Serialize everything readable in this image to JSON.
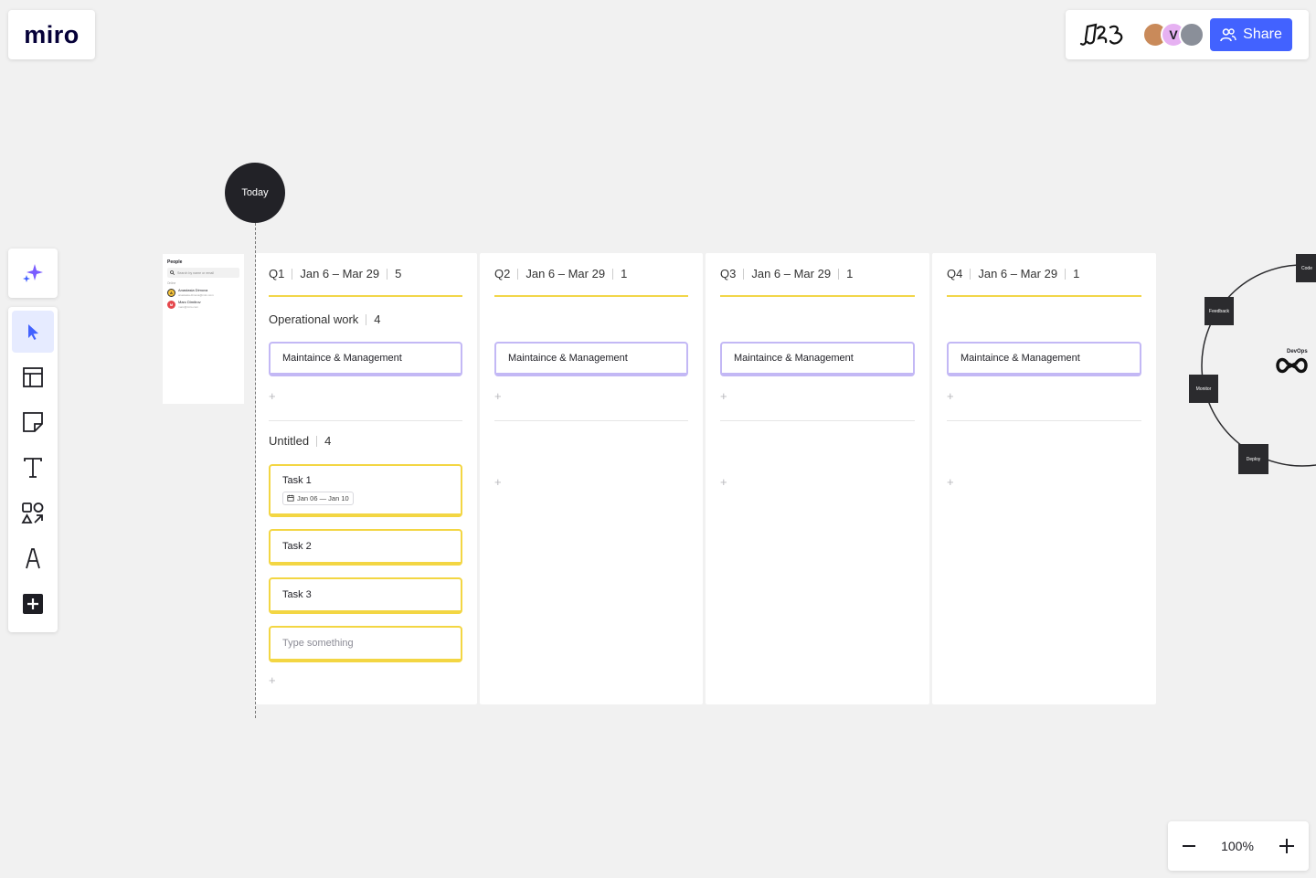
{
  "app": {
    "logo": "miro"
  },
  "header": {
    "share_label": "Share",
    "avatars": [
      {
        "initial": ""
      },
      {
        "initial": "V"
      },
      {
        "initial": ""
      }
    ]
  },
  "toolbar": {
    "tools": [
      "select",
      "templates",
      "sticky-note",
      "text",
      "shapes",
      "pen",
      "more"
    ],
    "active_tool": "select"
  },
  "zoom": {
    "level": "100%"
  },
  "timeline": {
    "today_label": "Today"
  },
  "people_panel": {
    "title": "People",
    "search_placeholder": "Search by name or email",
    "section_label": "Online",
    "people": [
      {
        "initial": "A",
        "name": "Anastasia Dimova",
        "email": "anastasia.dimova@miro.com",
        "color": "#f5c33b"
      },
      {
        "initial": "M",
        "name": "Marc Dimitrov",
        "email": "marc@miro.com",
        "color": "#e5484d"
      }
    ]
  },
  "columns": [
    {
      "quarter": "Q1",
      "range": "Jan 6 – Mar 29",
      "count": "5",
      "group1": {
        "title": "Operational work",
        "count": "4",
        "card": "Maintaince & Management"
      },
      "group2": {
        "title": "Untitled",
        "count": "4",
        "tasks": [
          {
            "label": "Task 1",
            "date": "Jan 06 — Jan 10"
          },
          {
            "label": "Task 2"
          },
          {
            "label": "Task 3"
          }
        ],
        "input_placeholder": "Type something"
      }
    },
    {
      "quarter": "Q2",
      "range": "Jan 6 – Mar 29",
      "count": "1",
      "card": "Maintaince & Management"
    },
    {
      "quarter": "Q3",
      "range": "Jan 6 – Mar 29",
      "count": "1",
      "card": "Maintaince & Management"
    },
    {
      "quarter": "Q4",
      "range": "Jan 6 – Mar 29",
      "count": "1",
      "card": "Maintaince & Management"
    }
  ],
  "add_symbol": "+",
  "devops": {
    "title": "DevOps",
    "nodes": [
      "Code",
      "Feedback",
      "Monitor",
      "Deploy"
    ]
  },
  "colors": {
    "accent": "#4262ff",
    "quarter_rule": "#f2d649",
    "card_purple": "#c3b8f5",
    "card_yellow": "#f3d643"
  }
}
